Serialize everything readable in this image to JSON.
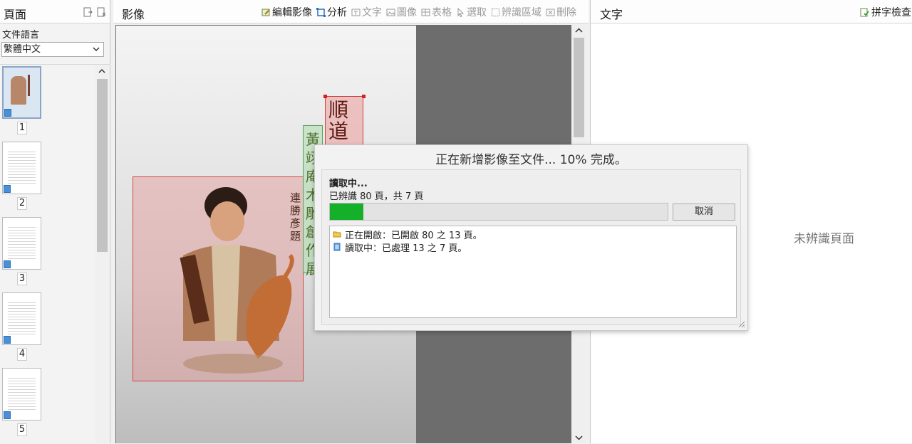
{
  "pages_panel": {
    "title": "頁面",
    "language_label": "文件語言",
    "language_value": "繁體中文",
    "thumbnails": [
      {
        "number": "1"
      },
      {
        "number": "2"
      },
      {
        "number": "3"
      },
      {
        "number": "4"
      },
      {
        "number": "5"
      }
    ]
  },
  "image_panel": {
    "title": "影像",
    "toolbar": {
      "edit_image": "編輯影像",
      "analyze": "分析",
      "text": "文字",
      "picture": "圖像",
      "table": "表格",
      "select": "選取",
      "recognition_area": "辨識區域",
      "delete": "刪除"
    }
  },
  "text_panel": {
    "title": "文字",
    "spell_check": "拼字檢查",
    "empty_message": "未辨識頁面"
  },
  "dialog": {
    "title": "正在新增影像至文件... 10% 完成。",
    "status": "讀取中...",
    "recognized": "已辨識 80 頁，共 7 頁",
    "progress": 0.1,
    "cancel": "取消",
    "log": [
      {
        "text": "正在開啟：已開啟 80 之 13 頁。",
        "icon": "folder-icon"
      },
      {
        "text": "讀取中：已處理 13 之 7 頁。",
        "icon": "page-icon"
      }
    ]
  },
  "colors": {
    "progress_fill": "#14b02a",
    "region_picture": "#d04545",
    "region_text_green": "#53a053"
  }
}
